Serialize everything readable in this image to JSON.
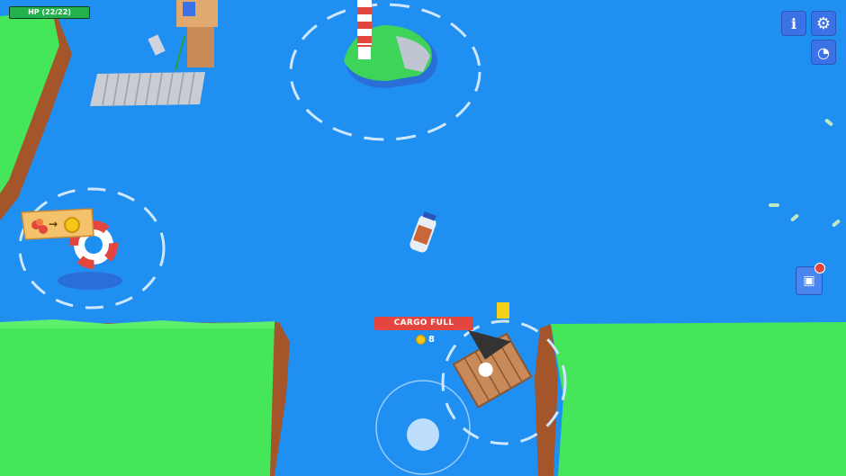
{
  "hud": {
    "hp_label": "HP (22/22)",
    "hp_fraction": 1.0
  },
  "buttons": {
    "info_icon": "info-icon",
    "settings_icon": "gear-icon",
    "map_icon": "compass-icon",
    "inventory_icon": "backpack-icon"
  },
  "player": {
    "status_label": "CARGO FULL",
    "coin_count": "8"
  },
  "trade_sign": {
    "from_icon": "wood-logs-icon",
    "arrow": "→",
    "to_icon": "coin-icon"
  },
  "colors": {
    "water": "#1f8ff2",
    "grass": "#45e65a",
    "cliff": "#a4552a",
    "hp_green": "#22b14c",
    "cargo_red": "#e2463f",
    "button_blue": "#3b73e6"
  }
}
